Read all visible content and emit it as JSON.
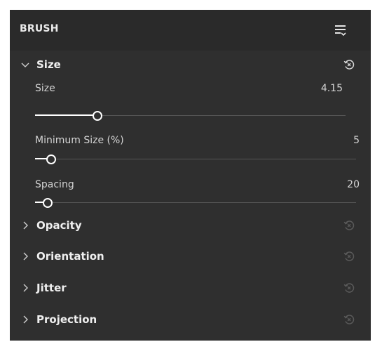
{
  "panel": {
    "title": "BRUSH",
    "menu_icon": "list-menu-icon"
  },
  "groups": [
    {
      "title": "Size",
      "expanded": true,
      "properties": [
        {
          "label": "Size",
          "value": "4.15",
          "slider_level": 0.2
        },
        {
          "label": "Minimum Size (%)",
          "value": "5",
          "slider_level": 0.05
        },
        {
          "label": "Spacing",
          "value": "20",
          "slider_level": 0.04
        }
      ]
    },
    {
      "title": "Opacity",
      "expanded": false
    },
    {
      "title": "Orientation",
      "expanded": false
    },
    {
      "title": "Jitter",
      "expanded": false
    },
    {
      "title": "Projection",
      "expanded": false
    }
  ],
  "colors": {
    "panel_bg": "#2f2f2f",
    "header_bg": "#2a2a2a",
    "text": "#e6e6e6",
    "reset_active": "#d8d8d8",
    "reset_inactive": "#5a5a5a"
  }
}
